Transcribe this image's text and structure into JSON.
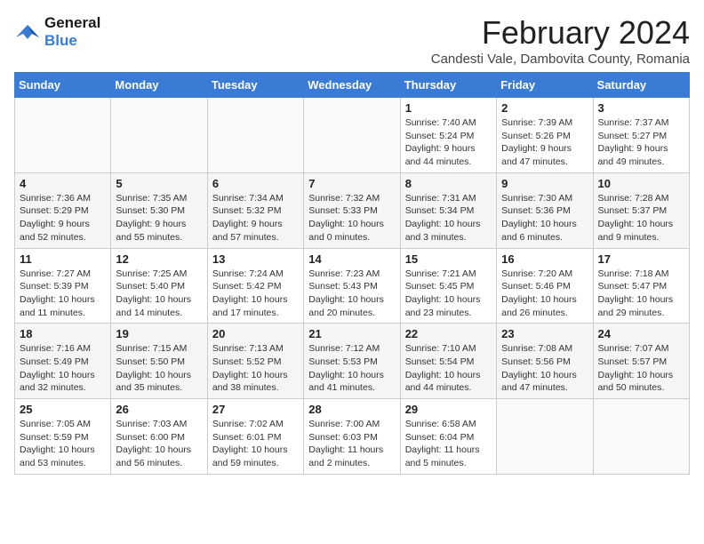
{
  "logo": {
    "line1": "General",
    "line2": "Blue"
  },
  "title": "February 2024",
  "subtitle": "Candesti Vale, Dambovita County, Romania",
  "weekdays": [
    "Sunday",
    "Monday",
    "Tuesday",
    "Wednesday",
    "Thursday",
    "Friday",
    "Saturday"
  ],
  "weeks": [
    [
      {
        "day": "",
        "info": ""
      },
      {
        "day": "",
        "info": ""
      },
      {
        "day": "",
        "info": ""
      },
      {
        "day": "",
        "info": ""
      },
      {
        "day": "1",
        "info": "Sunrise: 7:40 AM\nSunset: 5:24 PM\nDaylight: 9 hours\nand 44 minutes."
      },
      {
        "day": "2",
        "info": "Sunrise: 7:39 AM\nSunset: 5:26 PM\nDaylight: 9 hours\nand 47 minutes."
      },
      {
        "day": "3",
        "info": "Sunrise: 7:37 AM\nSunset: 5:27 PM\nDaylight: 9 hours\nand 49 minutes."
      }
    ],
    [
      {
        "day": "4",
        "info": "Sunrise: 7:36 AM\nSunset: 5:29 PM\nDaylight: 9 hours\nand 52 minutes."
      },
      {
        "day": "5",
        "info": "Sunrise: 7:35 AM\nSunset: 5:30 PM\nDaylight: 9 hours\nand 55 minutes."
      },
      {
        "day": "6",
        "info": "Sunrise: 7:34 AM\nSunset: 5:32 PM\nDaylight: 9 hours\nand 57 minutes."
      },
      {
        "day": "7",
        "info": "Sunrise: 7:32 AM\nSunset: 5:33 PM\nDaylight: 10 hours\nand 0 minutes."
      },
      {
        "day": "8",
        "info": "Sunrise: 7:31 AM\nSunset: 5:34 PM\nDaylight: 10 hours\nand 3 minutes."
      },
      {
        "day": "9",
        "info": "Sunrise: 7:30 AM\nSunset: 5:36 PM\nDaylight: 10 hours\nand 6 minutes."
      },
      {
        "day": "10",
        "info": "Sunrise: 7:28 AM\nSunset: 5:37 PM\nDaylight: 10 hours\nand 9 minutes."
      }
    ],
    [
      {
        "day": "11",
        "info": "Sunrise: 7:27 AM\nSunset: 5:39 PM\nDaylight: 10 hours\nand 11 minutes."
      },
      {
        "day": "12",
        "info": "Sunrise: 7:25 AM\nSunset: 5:40 PM\nDaylight: 10 hours\nand 14 minutes."
      },
      {
        "day": "13",
        "info": "Sunrise: 7:24 AM\nSunset: 5:42 PM\nDaylight: 10 hours\nand 17 minutes."
      },
      {
        "day": "14",
        "info": "Sunrise: 7:23 AM\nSunset: 5:43 PM\nDaylight: 10 hours\nand 20 minutes."
      },
      {
        "day": "15",
        "info": "Sunrise: 7:21 AM\nSunset: 5:45 PM\nDaylight: 10 hours\nand 23 minutes."
      },
      {
        "day": "16",
        "info": "Sunrise: 7:20 AM\nSunset: 5:46 PM\nDaylight: 10 hours\nand 26 minutes."
      },
      {
        "day": "17",
        "info": "Sunrise: 7:18 AM\nSunset: 5:47 PM\nDaylight: 10 hours\nand 29 minutes."
      }
    ],
    [
      {
        "day": "18",
        "info": "Sunrise: 7:16 AM\nSunset: 5:49 PM\nDaylight: 10 hours\nand 32 minutes."
      },
      {
        "day": "19",
        "info": "Sunrise: 7:15 AM\nSunset: 5:50 PM\nDaylight: 10 hours\nand 35 minutes."
      },
      {
        "day": "20",
        "info": "Sunrise: 7:13 AM\nSunset: 5:52 PM\nDaylight: 10 hours\nand 38 minutes."
      },
      {
        "day": "21",
        "info": "Sunrise: 7:12 AM\nSunset: 5:53 PM\nDaylight: 10 hours\nand 41 minutes."
      },
      {
        "day": "22",
        "info": "Sunrise: 7:10 AM\nSunset: 5:54 PM\nDaylight: 10 hours\nand 44 minutes."
      },
      {
        "day": "23",
        "info": "Sunrise: 7:08 AM\nSunset: 5:56 PM\nDaylight: 10 hours\nand 47 minutes."
      },
      {
        "day": "24",
        "info": "Sunrise: 7:07 AM\nSunset: 5:57 PM\nDaylight: 10 hours\nand 50 minutes."
      }
    ],
    [
      {
        "day": "25",
        "info": "Sunrise: 7:05 AM\nSunset: 5:59 PM\nDaylight: 10 hours\nand 53 minutes."
      },
      {
        "day": "26",
        "info": "Sunrise: 7:03 AM\nSunset: 6:00 PM\nDaylight: 10 hours\nand 56 minutes."
      },
      {
        "day": "27",
        "info": "Sunrise: 7:02 AM\nSunset: 6:01 PM\nDaylight: 10 hours\nand 59 minutes."
      },
      {
        "day": "28",
        "info": "Sunrise: 7:00 AM\nSunset: 6:03 PM\nDaylight: 11 hours\nand 2 minutes."
      },
      {
        "day": "29",
        "info": "Sunrise: 6:58 AM\nSunset: 6:04 PM\nDaylight: 11 hours\nand 5 minutes."
      },
      {
        "day": "",
        "info": ""
      },
      {
        "day": "",
        "info": ""
      }
    ]
  ]
}
